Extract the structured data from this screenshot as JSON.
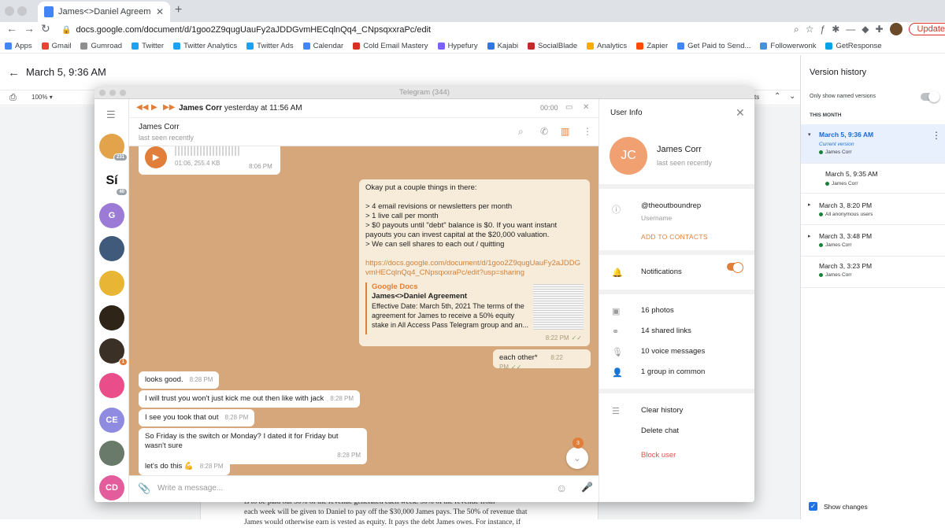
{
  "browser": {
    "tab_title": "James<>Daniel Agreement - G",
    "new_tab": "+",
    "url": "docs.google.com/document/d/1goo2Z9qugUauFy2aJDDGvmHECqlnQq4_CNpsqxxraPc/edit",
    "update_label": "Update",
    "bookmarks": [
      "Apps",
      "Gmail",
      "Gumroad",
      "Twitter",
      "Twitter Analytics",
      "Twitter Ads",
      "Calendar",
      "Cold Email Mastery",
      "Hypefury",
      "Kajabi",
      "SocialBlade",
      "Analytics",
      "Zapier",
      "Get Paid to Send...",
      "Followerwonk",
      "GetResponse"
    ],
    "bookmark_colors": [
      "#4285f4",
      "#ea4335",
      "#8e8e8e",
      "#1da1f2",
      "#1da1f2",
      "#1da1f2",
      "#4285f4",
      "#d93025",
      "#7b61ff",
      "#2a7ae2",
      "#c62828",
      "#f9ab00",
      "#ff4a00",
      "#4285f4",
      "#4a90d9",
      "#00a2e8"
    ]
  },
  "docs": {
    "version_date": "March 5, 9:36 AM",
    "zoom": "100%",
    "toolbar_fragment": "ts",
    "doc_text_lines": [
      "is to be paid out 50% of the revenue generated each week. 50% of the revenue from",
      "each week will be given to Daniel to pay off the $30,000 James pays. The 50% of revenue that",
      "James would otherwise earn is vested as equity. It pays the debt James owes. For instance, if"
    ]
  },
  "version_history": {
    "title": "Version history",
    "named_only_label": "Only show named versions",
    "month_label": "THIS MONTH",
    "versions": [
      {
        "date": "March 5, 9:36 AM",
        "sub": "Current version",
        "author": "James Corr"
      },
      {
        "date": "March 5, 9:35 AM",
        "author": "James Corr"
      },
      {
        "date": "March 3, 8:20 PM",
        "author": "All anonymous users"
      },
      {
        "date": "March 3, 3:48 PM",
        "author": "James Corr"
      },
      {
        "date": "March 3, 3:23 PM",
        "author": "James Corr"
      }
    ],
    "show_changes_label": "Show changes"
  },
  "telegram": {
    "window_title": "Telegram (344)",
    "sidebar_chats": [
      {
        "initials": "",
        "color": "#e3a34a",
        "badge": "231"
      },
      {
        "initials": "Sí",
        "color": "#ffffff",
        "badge": "40"
      },
      {
        "initials": "G",
        "color": "#9b7bd6",
        "badge": ""
      },
      {
        "initials": "",
        "color": "#3f5a7a",
        "badge": ""
      },
      {
        "initials": "",
        "color": "#e8b534",
        "badge": ""
      },
      {
        "initials": "",
        "color": "#2e2418",
        "badge": ""
      },
      {
        "initials": "",
        "color": "#3a3025",
        "badge": "1"
      },
      {
        "initials": "",
        "color": "#e94d8a",
        "badge": ""
      },
      {
        "initials": "CE",
        "color": "#8f8be0",
        "badge": ""
      },
      {
        "initials": "",
        "color": "#6a7a6a",
        "badge": ""
      },
      {
        "initials": "CD",
        "color": "#e35d9d",
        "badge": ""
      }
    ],
    "audio_bar": {
      "sender": "James Corr",
      "when": "yesterday at 11:56 AM",
      "duration": "00:00"
    },
    "chat_header": {
      "name": "James Corr",
      "status": "last seen recently"
    },
    "voice_message": {
      "meta": "01:06, 255.4 KB",
      "time": "8:06 PM"
    },
    "big_message": {
      "lines": [
        "Okay put a couple things in there:",
        "",
        "> 4 email revisions or newsletters per month",
        "> 1 live call per month",
        "> $0 payouts until \"debt\" balance is $0. If you want instant payouts you can invest capital at the $20,000 valuation.",
        "> We can sell shares to each out / quitting"
      ],
      "link": "https://docs.google.com/document/d/1goo2Z9qugUauFy2aJDDGvmHECqlnQq4_CNpsqxxraPc/edit?usp=sharing",
      "preview_site": "Google Docs",
      "preview_title": "James<>Daniel Agreement",
      "preview_desc": "Effective Date: March 5th, 2021  The terms of the agreement for James to receive a 50% equity stake in All Access Pass Telegram group and an...",
      "time": "8:22 PM"
    },
    "each_other": {
      "text": "each other*",
      "time": "8:22 PM"
    },
    "incoming": [
      {
        "text": "looks good.",
        "time": "8:28 PM"
      },
      {
        "text": "I will trust you won't just kick me out then like with jack",
        "time": "8:28 PM"
      },
      {
        "text": "I see you took that out",
        "time": "8:28 PM"
      },
      {
        "text": "So Friday is the switch or Monday? I dated it for Friday but wasn't sure",
        "time": "8:28 PM"
      },
      {
        "text": "let's do this 💪",
        "time": "8:28 PM"
      }
    ],
    "unread_count": "3",
    "compose_placeholder": "Write a message...",
    "user_info": {
      "title": "User Info",
      "initials": "JC",
      "name": "James Corr",
      "status": "last seen recently",
      "username": "@theoutboundrep",
      "username_label": "Username",
      "add_contact": "ADD TO CONTACTS",
      "notifications": "Notifications",
      "photos": "16 photos",
      "links": "14 shared links",
      "voice": "10 voice messages",
      "groups": "1 group in common",
      "clear_history": "Clear history",
      "delete_chat": "Delete chat",
      "block_user": "Block user"
    }
  }
}
